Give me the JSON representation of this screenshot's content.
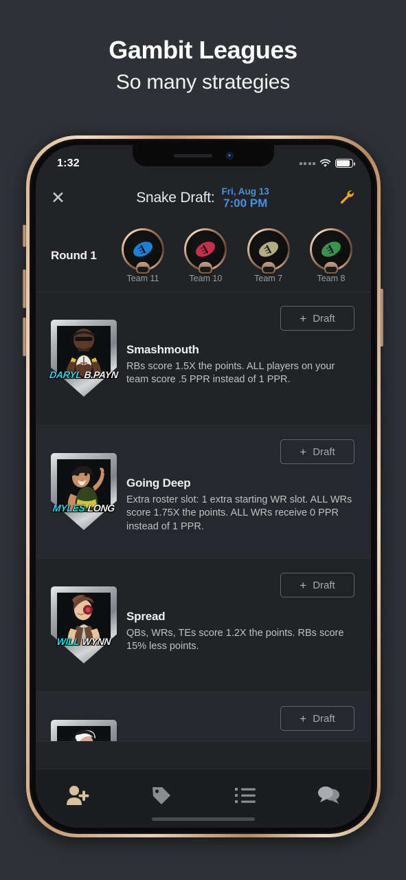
{
  "promo": {
    "title": "Gambit Leagues",
    "subtitle": "So many strategies"
  },
  "status_bar": {
    "time": "1:32",
    "signal_icon": "signal-dots-icon",
    "wifi_icon": "wifi-icon",
    "battery_icon": "battery-icon"
  },
  "header": {
    "close_icon": "close-icon",
    "title": "Snake Draft:",
    "date": "Fri, Aug 13",
    "time": "7:00 PM",
    "settings_icon": "wrench-icon",
    "accent_color": "#4a90e2",
    "wrench_color": "#f5a623"
  },
  "round": {
    "label": "Round 1",
    "teams": [
      {
        "name": "Team 11",
        "ball_color": "#1f7fd4"
      },
      {
        "name": "Team 10",
        "ball_color": "#c4304a"
      },
      {
        "name": "Team 7",
        "ball_color": "#b3ab84"
      },
      {
        "name": "Team 8",
        "ball_color": "#3c9350"
      }
    ]
  },
  "strategies": [
    {
      "title": "Smashmouth",
      "description": "RBs score 1.5X the points. ALL players on your team score .5 PPR instead of 1 PPR.",
      "draft_label": "Draft",
      "badge_name_first": "DARYL",
      "badge_name_last": "B.PAYN",
      "char_skin": "#5d3a28",
      "char_shirt": "#1b1b1d",
      "char_accent": "#e0b93c"
    },
    {
      "title": "Going Deep",
      "description": "Extra roster slot: 1 extra starting WR slot. ALL WRs score 1.75X the points. ALL WRs receive 0 PPR instead of 1 PPR.",
      "draft_label": "Draft",
      "badge_name_first": "MYLES",
      "badge_name_last": "LONG",
      "char_skin": "#c98d63",
      "char_shirt": "#33451f",
      "char_accent": "#d6c13c"
    },
    {
      "title": "Spread",
      "description": "QBs, WRs, TEs score 1.2X the points. RBs score 15% less points.",
      "draft_label": "Draft",
      "badge_name_first": "WILL",
      "badge_name_last": "WYNN",
      "char_skin": "#e8c49e",
      "char_shirt": "#6b4a33",
      "char_accent": "#8a5d3b"
    },
    {
      "title": "",
      "description": "",
      "draft_label": "Draft",
      "badge_name_first": "",
      "badge_name_last": "",
      "char_skin": "#e0a894",
      "char_shirt": "#2a2a2c",
      "char_accent": "#f0f0f0"
    }
  ],
  "tabbar": {
    "items": [
      {
        "icon": "add-person-icon",
        "active": true
      },
      {
        "icon": "tag-icon",
        "active": false
      },
      {
        "icon": "list-icon",
        "active": false
      },
      {
        "icon": "chat-icon",
        "active": false
      }
    ],
    "active_color": "#d8c19b",
    "inactive_color": "#8b8d92"
  }
}
